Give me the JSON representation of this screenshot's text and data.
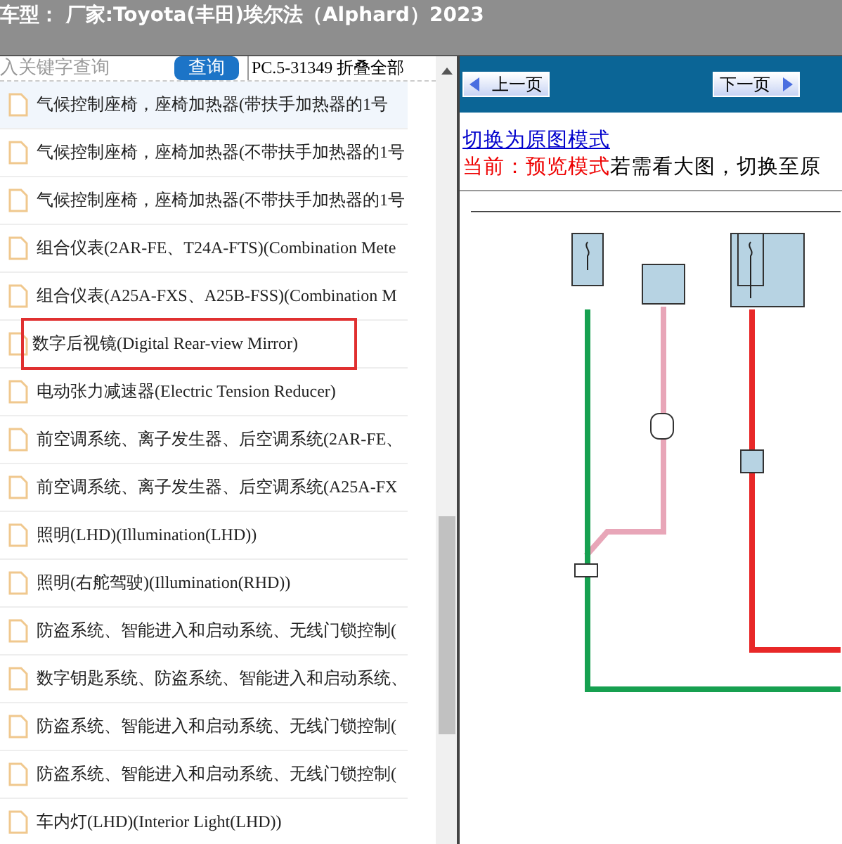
{
  "title_bar": {
    "title": "车型： 厂家:Toyota(丰田)埃尔法（Alphard）2023"
  },
  "search": {
    "placeholder": "入关键字查询",
    "button": "查询",
    "info": "PC.5-31349 折叠全部"
  },
  "document_list": {
    "items": [
      {
        "label": "气候控制座椅，座椅加热器(带扶手加热器的1号",
        "selected": true,
        "highlighted": false
      },
      {
        "label": "气候控制座椅，座椅加热器(不带扶手加热器的1号",
        "selected": false,
        "highlighted": false
      },
      {
        "label": "气候控制座椅，座椅加热器(不带扶手加热器的1号",
        "selected": false,
        "highlighted": false
      },
      {
        "label": "组合仪表(2AR-FE、T24A-FTS)(Combination Mete",
        "selected": false,
        "highlighted": false
      },
      {
        "label": "组合仪表(A25A-FXS、A25B-FSS)(Combination M",
        "selected": false,
        "highlighted": false
      },
      {
        "label": "数字后视镜(Digital Rear-view Mirror)",
        "selected": false,
        "highlighted": true
      },
      {
        "label": "电动张力减速器(Electric Tension Reducer)",
        "selected": false,
        "highlighted": false
      },
      {
        "label": "前空调系统、离子发生器、后空调系统(2AR-FE、",
        "selected": false,
        "highlighted": false
      },
      {
        "label": "前空调系统、离子发生器、后空调系统(A25A-FX",
        "selected": false,
        "highlighted": false
      },
      {
        "label": "照明(LHD)(Illumination(LHD))",
        "selected": false,
        "highlighted": false
      },
      {
        "label": "照明(右舵驾驶)(Illumination(RHD))",
        "selected": false,
        "highlighted": false
      },
      {
        "label": "防盗系统、智能进入和启动系统、无线门锁控制(",
        "selected": false,
        "highlighted": false
      },
      {
        "label": "数字钥匙系统、防盗系统、智能进入和启动系统、",
        "selected": false,
        "highlighted": false
      },
      {
        "label": "防盗系统、智能进入和启动系统、无线门锁控制(",
        "selected": false,
        "highlighted": false
      },
      {
        "label": "防盗系统、智能进入和启动系统、无线门锁控制(",
        "selected": false,
        "highlighted": false
      },
      {
        "label": "车内灯(LHD)(Interior Light(LHD))",
        "selected": false,
        "highlighted": false
      }
    ]
  },
  "viewer": {
    "prev_button": "上一页",
    "next_button": "下一页",
    "mode_link": "切换为原图模式",
    "mode_label": "当前：预览模式",
    "mode_hint": "若需看大图，切换至原"
  }
}
